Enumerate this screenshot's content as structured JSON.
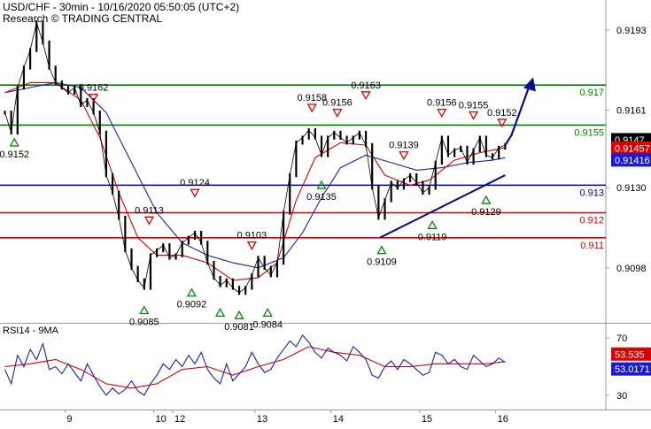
{
  "header": {
    "title": "USD/CHF - 30min - 10/16/2020 05:50:05 (UTC+2)",
    "source": "Research © TRADING CENTRAL"
  },
  "rsi_panel": {
    "title": "RSI14 - 9MA"
  },
  "colors": {
    "green": "#008000",
    "blue": "#00008b",
    "red": "#dd0000",
    "price": "#000000",
    "ma_red": "#cc0000",
    "ma_blue": "#1f1fa8",
    "arrow": "#0a0a8c",
    "axis": "#9a9a9a"
  },
  "chart_data": [
    {
      "type": "line",
      "name": "price-panel",
      "ylim": [
        0.9076,
        0.9205
      ],
      "xlim": [
        0,
        100
      ],
      "yaxis_ticks": [
        "0.9193",
        "0.9161",
        "0.9130",
        "0.9098"
      ],
      "yaxis_tick_values": [
        0.9193,
        0.9161,
        0.913,
        0.9098
      ],
      "xaxis_ticks": [
        {
          "label": "9",
          "x": 9.5
        },
        {
          "label": "10",
          "x": 23.5
        },
        {
          "label": "12",
          "x": 26.5
        },
        {
          "label": "13",
          "x": 39.5
        },
        {
          "label": "14",
          "x": 51.5
        },
        {
          "label": "15",
          "x": 65.5
        },
        {
          "label": "16",
          "x": 77.5
        }
      ],
      "levels": [
        {
          "value": 0.9171,
          "label": "0.917",
          "color": "#008000"
        },
        {
          "value": 0.9155,
          "label": "0.9155",
          "color": "#008000"
        },
        {
          "value": 0.9131,
          "label": "0.913",
          "color": "#00008b"
        },
        {
          "value": 0.912,
          "label": "0.912",
          "color": "#dd0000"
        },
        {
          "value": 0.911,
          "label": "0.911",
          "color": "#dd0000"
        }
      ],
      "price_tags": [
        {
          "value": 0.91483,
          "label": "0.9147",
          "bg": "#000000",
          "fg": "#ffffff"
        },
        {
          "value": 0.91457,
          "label": "0.91457",
          "bg": "#dd0000",
          "fg": "#ffffff"
        },
        {
          "value": 0.91416,
          "label": "0.91416",
          "bg": "#1a1ad0",
          "fg": "#ffffff"
        }
      ],
      "highs": [
        {
          "x": 14.0,
          "y": 0.9162,
          "label": "0.9162"
        },
        {
          "x": 22.8,
          "y": 0.9113,
          "label": "0.9113"
        },
        {
          "x": 30.0,
          "y": 0.9124,
          "label": "0.9124"
        },
        {
          "x": 39.0,
          "y": 0.9103,
          "label": "0.9103"
        },
        {
          "x": 48.5,
          "y": 0.9158,
          "label": "0.9158"
        },
        {
          "x": 52.5,
          "y": 0.9156,
          "label": "0.9156"
        },
        {
          "x": 57.0,
          "y": 0.9163,
          "label": "0.9163"
        },
        {
          "x": 63.0,
          "y": 0.9139,
          "label": "0.9139"
        },
        {
          "x": 69.0,
          "y": 0.9156,
          "label": "0.9156"
        },
        {
          "x": 74.0,
          "y": 0.9155,
          "label": "0.9155"
        },
        {
          "x": 78.5,
          "y": 0.9152,
          "label": "0.9152"
        }
      ],
      "lows": [
        {
          "x": 1.5,
          "y": 0.9152,
          "label": "0.9152"
        },
        {
          "x": 22.0,
          "y": 0.9085,
          "label": "0.9085"
        },
        {
          "x": 29.5,
          "y": 0.9092,
          "label": "0.9092"
        },
        {
          "x": 34.0,
          "y": 0.9084,
          "label": ""
        },
        {
          "x": 37.0,
          "y": 0.9083,
          "label": "0.9081"
        },
        {
          "x": 41.5,
          "y": 0.9084,
          "label": "0.9084"
        },
        {
          "x": 50.0,
          "y": 0.9135,
          "label": "0.9135"
        },
        {
          "x": 59.5,
          "y": 0.9109,
          "label": "0.9109"
        },
        {
          "x": 67.5,
          "y": 0.9119,
          "label": "0.9119"
        },
        {
          "x": 76.0,
          "y": 0.9129,
          "label": "0.9129"
        }
      ],
      "trendline": [
        {
          "x": 59.2,
          "y": 0.911
        },
        {
          "x": 79.0,
          "y": 0.9135
        }
      ],
      "projection": [
        {
          "x": 79.0,
          "y": 0.9147
        },
        {
          "x": 80.0,
          "y": 0.9151
        },
        {
          "x": 83.0,
          "y": 0.9172
        }
      ],
      "series": [
        {
          "name": "price",
          "x": [
            0,
            1,
            2,
            3,
            4,
            5,
            6,
            7,
            8,
            9,
            10,
            11,
            12,
            13,
            14,
            15,
            16,
            17,
            18,
            19,
            20,
            21,
            22,
            23,
            24,
            25,
            26,
            27,
            28,
            29,
            30,
            31,
            32,
            33,
            34,
            35,
            36,
            37,
            38,
            39,
            40,
            41,
            42,
            43,
            44,
            45,
            46,
            47,
            48,
            49,
            50,
            51,
            52,
            53,
            54,
            55,
            56,
            57,
            58,
            59,
            60,
            61,
            62,
            63,
            64,
            65,
            66,
            67,
            68,
            69,
            70,
            71,
            72,
            73,
            74,
            75,
            76,
            77,
            78,
            79
          ],
          "y": [
            0.916,
            0.9152,
            0.917,
            0.9178,
            0.9185,
            0.9196,
            0.9188,
            0.9178,
            0.9172,
            0.917,
            0.9168,
            0.917,
            0.9163,
            0.9165,
            0.916,
            0.9152,
            0.9135,
            0.9128,
            0.9118,
            0.9105,
            0.9098,
            0.9093,
            0.909,
            0.9103,
            0.9105,
            0.9107,
            0.9102,
            0.9103,
            0.9108,
            0.911,
            0.9112,
            0.9108,
            0.91,
            0.9094,
            0.9091,
            0.9093,
            0.909,
            0.9088,
            0.909,
            0.9095,
            0.9102,
            0.9098,
            0.9095,
            0.91,
            0.912,
            0.9135,
            0.9148,
            0.915,
            0.9153,
            0.915,
            0.9143,
            0.915,
            0.9152,
            0.915,
            0.9148,
            0.915,
            0.9152,
            0.9147,
            0.913,
            0.9118,
            0.9125,
            0.9132,
            0.913,
            0.9133,
            0.9135,
            0.9132,
            0.9128,
            0.913,
            0.914,
            0.915,
            0.9143,
            0.9145,
            0.9146,
            0.914,
            0.9145,
            0.915,
            0.9143,
            0.9142,
            0.9146,
            0.9147
          ]
        },
        {
          "name": "MA red",
          "x": [
            0,
            4,
            8,
            12,
            15,
            18,
            21,
            24,
            28,
            32,
            36,
            40,
            43,
            46,
            49,
            53,
            57,
            60,
            64,
            67,
            71,
            75,
            79
          ],
          "y": [
            0.9168,
            0.9172,
            0.9172,
            0.9165,
            0.915,
            0.9128,
            0.911,
            0.9103,
            0.9103,
            0.91,
            0.9093,
            0.9094,
            0.91,
            0.9125,
            0.9142,
            0.9148,
            0.9147,
            0.9135,
            0.9131,
            0.9133,
            0.9141,
            0.9144,
            0.9146
          ]
        },
        {
          "name": "MA blue",
          "x": [
            0,
            4,
            8,
            12,
            16,
            20,
            24,
            28,
            32,
            36,
            40,
            44,
            47,
            50,
            53,
            57,
            61,
            65,
            69,
            73,
            77,
            79
          ],
          "y": [
            0.9168,
            0.917,
            0.9172,
            0.917,
            0.916,
            0.914,
            0.912,
            0.9108,
            0.9103,
            0.91,
            0.9098,
            0.9102,
            0.9112,
            0.9126,
            0.9138,
            0.9143,
            0.914,
            0.9137,
            0.9138,
            0.914,
            0.9141,
            0.9142
          ]
        }
      ]
    },
    {
      "type": "line",
      "name": "rsi-panel",
      "title": "RSI14 - 9MA",
      "ylim": [
        20,
        80
      ],
      "xlim": [
        0,
        100
      ],
      "yaxis_ticks": [
        "70",
        "30"
      ],
      "yaxis_tick_values": [
        70,
        30
      ],
      "value_tags": [
        {
          "value": 53.535,
          "label": "53.535",
          "bg": "#dd0000",
          "fg": "#ffffff"
        },
        {
          "value": 53.0171,
          "label": "53.0171",
          "bg": "#1a1ad0",
          "fg": "#ffffff"
        }
      ],
      "series": [
        {
          "name": "RSI14",
          "x": [
            0,
            1,
            2,
            3,
            4,
            5,
            6,
            7,
            8,
            9,
            10,
            11,
            12,
            13,
            14,
            15,
            16,
            17,
            18,
            19,
            20,
            21,
            22,
            23,
            24,
            25,
            26,
            27,
            28,
            29,
            30,
            31,
            32,
            33,
            34,
            35,
            36,
            37,
            38,
            39,
            40,
            41,
            42,
            43,
            44,
            45,
            46,
            47,
            48,
            49,
            50,
            51,
            52,
            53,
            54,
            55,
            56,
            57,
            58,
            59,
            60,
            61,
            62,
            63,
            64,
            65,
            66,
            67,
            68,
            69,
            70,
            71,
            72,
            73,
            74,
            75,
            76,
            77,
            78,
            79
          ],
          "y": [
            48,
            38,
            58,
            50,
            62,
            55,
            66,
            48,
            50,
            45,
            52,
            46,
            40,
            52,
            44,
            36,
            30,
            35,
            31,
            34,
            40,
            33,
            30,
            38,
            44,
            52,
            48,
            55,
            50,
            58,
            52,
            60,
            48,
            42,
            38,
            52,
            40,
            45,
            50,
            60,
            52,
            46,
            48,
            56,
            62,
            68,
            64,
            72,
            67,
            60,
            56,
            63,
            60,
            58,
            54,
            64,
            60,
            55,
            44,
            42,
            50,
            54,
            48,
            55,
            52,
            48,
            44,
            46,
            60,
            58,
            52,
            55,
            50,
            48,
            58,
            54,
            50,
            52,
            56,
            53
          ]
        },
        {
          "name": "9MA",
          "x": [
            0,
            4,
            8,
            12,
            16,
            20,
            24,
            28,
            32,
            36,
            40,
            44,
            48,
            52,
            56,
            60,
            64,
            68,
            72,
            76,
            79
          ],
          "y": [
            50,
            52,
            55,
            48,
            38,
            35,
            38,
            48,
            50,
            44,
            50,
            55,
            64,
            60,
            58,
            50,
            50,
            52,
            52,
            52,
            53.5
          ]
        }
      ]
    }
  ]
}
